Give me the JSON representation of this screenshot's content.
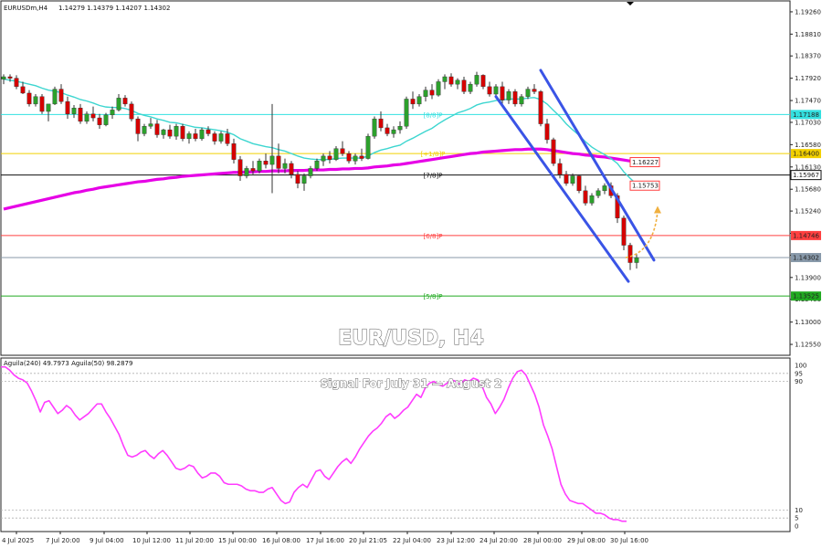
{
  "header": {
    "symbol": "EURUSDm,H4",
    "ohlc": "1.14279 1.14379 1.14207 1.14302"
  },
  "overlay": {
    "title": "EUR/USD, H4",
    "subtitle": "Signal For July 31 — August 2"
  },
  "colors": {
    "bull": "#2ca02c",
    "bear": "#d40000",
    "ema21": "#3dd6d0",
    "ema200": "#e600e6",
    "channel": "#3a54e6",
    "indicator": "#ff3cff",
    "arrow": "#f0b040"
  },
  "chart_data": [
    {
      "type": "candlestick",
      "name_label": "EURUSDm,H4",
      "y_ticks": [
        "1.19260",
        "1.18810",
        "1.18370",
        "1.17920",
        "1.17470",
        "1.17030",
        "1.16580",
        "1.16130",
        "1.15680",
        "1.15240",
        "1.14790",
        "1.14350",
        "1.13900",
        "1.13460",
        "1.13000",
        "1.12550"
      ],
      "ylim": [
        1.1233,
        1.1948
      ],
      "x_ticks": [
        "4 Jul 2025",
        "7 Jul 20:00",
        "9 Jul 04:00",
        "10 Jul 12:00",
        "11 Jul 20:00",
        "15 Jul 00:00",
        "16 Jul 08:00",
        "17 Jul 16:00",
        "20 Jul 21:05",
        "22 Jul 04:00",
        "23 Jul 12:00",
        "24 Jul 20:00",
        "28 Jul 00:00",
        "29 Jul 08:00",
        "30 Jul 16:00"
      ],
      "horizontal_lines": [
        {
          "label": "[+1/8]P",
          "value": 1.164,
          "price_label": "1.16400",
          "color": "#f2d000"
        },
        {
          "label": "[8/8]P",
          "value": 1.17188,
          "price_label": "1.17188",
          "color": "#33e0e0"
        },
        {
          "label": "[7/8]P",
          "value": 1.15967,
          "price_label": "1.15967",
          "color": "#111111"
        },
        {
          "label": "[6/8]P",
          "value": 1.14746,
          "price_label": "1.14746",
          "color": "#ff4040"
        },
        {
          "label": "[5/8]P",
          "value": 1.13525,
          "price_label": "1.13525",
          "color": "#22aa22"
        },
        {
          "label": "",
          "value": 1.14302,
          "price_label": "1.14302",
          "color": "#8899aa"
        }
      ],
      "annotations": [
        {
          "text": "1.16227",
          "value": 1.16227,
          "color": "#ff4040"
        },
        {
          "text": "1.15753",
          "value": 1.15753,
          "color": "#ff4040"
        }
      ],
      "candles": [
        [
          1.179,
          1.18,
          1.178,
          1.1795
        ],
        [
          1.1795,
          1.18,
          1.1785,
          1.1792
        ],
        [
          1.1792,
          1.1798,
          1.177,
          1.1775
        ],
        [
          1.1775,
          1.1785,
          1.176,
          1.1762
        ],
        [
          1.1762,
          1.1768,
          1.1735,
          1.174
        ],
        [
          1.174,
          1.176,
          1.1735,
          1.1755
        ],
        [
          1.1755,
          1.176,
          1.172,
          1.1725
        ],
        [
          1.1725,
          1.173,
          1.1705,
          1.174
        ],
        [
          1.174,
          1.1775,
          1.1738,
          1.177
        ],
        [
          1.177,
          1.178,
          1.174,
          1.1745
        ],
        [
          1.1745,
          1.1755,
          1.171,
          1.172
        ],
        [
          1.172,
          1.1738,
          1.1712,
          1.1732
        ],
        [
          1.1732,
          1.174,
          1.17,
          1.1705
        ],
        [
          1.1705,
          1.1725,
          1.17,
          1.172
        ],
        [
          1.172,
          1.1735,
          1.1705,
          1.1712
        ],
        [
          1.1712,
          1.172,
          1.169,
          1.1698
        ],
        [
          1.1698,
          1.1722,
          1.1695,
          1.1718
        ],
        [
          1.1718,
          1.1735,
          1.171,
          1.1728
        ],
        [
          1.1728,
          1.176,
          1.1725,
          1.1752
        ],
        [
          1.1752,
          1.1758,
          1.1735,
          1.174
        ],
        [
          1.174,
          1.1745,
          1.1705,
          1.171
        ],
        [
          1.171,
          1.1715,
          1.1665,
          1.168
        ],
        [
          1.168,
          1.17,
          1.1675,
          1.1695
        ],
        [
          1.1695,
          1.1712,
          1.169,
          1.17
        ],
        [
          1.17,
          1.1708,
          1.1672,
          1.1678
        ],
        [
          1.1678,
          1.169,
          1.167,
          1.1688
        ],
        [
          1.1688,
          1.1698,
          1.167,
          1.1675
        ],
        [
          1.1675,
          1.17,
          1.1668,
          1.1695
        ],
        [
          1.1695,
          1.17,
          1.1665,
          1.167
        ],
        [
          1.167,
          1.1685,
          1.166,
          1.168
        ],
        [
          1.168,
          1.169,
          1.1665,
          1.167
        ],
        [
          1.167,
          1.1692,
          1.1666,
          1.1688
        ],
        [
          1.1688,
          1.1695,
          1.1675,
          1.168
        ],
        [
          1.168,
          1.1685,
          1.1658,
          1.1665
        ],
        [
          1.1665,
          1.1685,
          1.166,
          1.168
        ],
        [
          1.168,
          1.169,
          1.1655,
          1.166
        ],
        [
          1.166,
          1.167,
          1.162,
          1.1628
        ],
        [
          1.1628,
          1.1635,
          1.1585,
          1.1595
        ],
        [
          1.1595,
          1.1615,
          1.159,
          1.161
        ],
        [
          1.161,
          1.1625,
          1.1598,
          1.1605
        ],
        [
          1.1605,
          1.163,
          1.16,
          1.1625
        ],
        [
          1.1625,
          1.164,
          1.161,
          1.1618
        ],
        [
          1.1618,
          1.174,
          1.156,
          1.1635
        ],
        [
          1.1635,
          1.166,
          1.16,
          1.161
        ],
        [
          1.161,
          1.163,
          1.16,
          1.162
        ],
        [
          1.162,
          1.1625,
          1.159,
          1.1598
        ],
        [
          1.1598,
          1.1605,
          1.157,
          1.158
        ],
        [
          1.158,
          1.16,
          1.1565,
          1.1595
        ],
        [
          1.1595,
          1.1615,
          1.159,
          1.161
        ],
        [
          1.161,
          1.163,
          1.1605,
          1.1625
        ],
        [
          1.1625,
          1.164,
          1.1615,
          1.1635
        ],
        [
          1.1635,
          1.1645,
          1.162,
          1.1628
        ],
        [
          1.1628,
          1.1655,
          1.1625,
          1.165
        ],
        [
          1.165,
          1.1665,
          1.1635,
          1.164
        ],
        [
          1.164,
          1.1645,
          1.162,
          1.1625
        ],
        [
          1.1625,
          1.164,
          1.1618,
          1.1635
        ],
        [
          1.1635,
          1.165,
          1.1625,
          1.163
        ],
        [
          1.163,
          1.168,
          1.1628,
          1.1675
        ],
        [
          1.1675,
          1.1715,
          1.167,
          1.171
        ],
        [
          1.171,
          1.1725,
          1.1685,
          1.1692
        ],
        [
          1.1692,
          1.17,
          1.1675,
          1.168
        ],
        [
          1.168,
          1.1695,
          1.1672,
          1.1688
        ],
        [
          1.1688,
          1.1705,
          1.168,
          1.1695
        ],
        [
          1.1695,
          1.1755,
          1.169,
          1.175
        ],
        [
          1.175,
          1.1765,
          1.173,
          1.174
        ],
        [
          1.174,
          1.176,
          1.1735,
          1.1755
        ],
        [
          1.1755,
          1.1775,
          1.1745,
          1.1768
        ],
        [
          1.1768,
          1.178,
          1.175,
          1.1758
        ],
        [
          1.1758,
          1.179,
          1.1755,
          1.1785
        ],
        [
          1.1785,
          1.18,
          1.177,
          1.1795
        ],
        [
          1.1795,
          1.1802,
          1.1775,
          1.178
        ],
        [
          1.178,
          1.1792,
          1.177,
          1.1788
        ],
        [
          1.1788,
          1.1795,
          1.176,
          1.1765
        ],
        [
          1.1765,
          1.1785,
          1.176,
          1.178
        ],
        [
          1.178,
          1.1805,
          1.1775,
          1.1798
        ],
        [
          1.1798,
          1.18,
          1.177,
          1.1775
        ],
        [
          1.1775,
          1.1785,
          1.1755,
          1.176
        ],
        [
          1.176,
          1.178,
          1.1755,
          1.1775
        ],
        [
          1.1775,
          1.1785,
          1.174,
          1.1748
        ],
        [
          1.1748,
          1.177,
          1.174,
          1.1765
        ],
        [
          1.1765,
          1.177,
          1.1735,
          1.174
        ],
        [
          1.174,
          1.176,
          1.1735,
          1.1755
        ],
        [
          1.1755,
          1.1775,
          1.175,
          1.177
        ],
        [
          1.177,
          1.178,
          1.176,
          1.1765
        ],
        [
          1.1765,
          1.1768,
          1.1695,
          1.17
        ],
        [
          1.17,
          1.171,
          1.166,
          1.1668
        ],
        [
          1.1668,
          1.1672,
          1.1615,
          1.162
        ],
        [
          1.162,
          1.163,
          1.159,
          1.1598
        ],
        [
          1.1598,
          1.1605,
          1.1575,
          1.158
        ],
        [
          1.158,
          1.16,
          1.1575,
          1.1595
        ],
        [
          1.1595,
          1.1598,
          1.156,
          1.1565
        ],
        [
          1.1565,
          1.1575,
          1.1535,
          1.154
        ],
        [
          1.154,
          1.156,
          1.1535,
          1.1555
        ],
        [
          1.1555,
          1.157,
          1.155,
          1.1565
        ],
        [
          1.1565,
          1.158,
          1.1558,
          1.1575
        ],
        [
          1.1575,
          1.1582,
          1.155,
          1.1555
        ],
        [
          1.1555,
          1.156,
          1.15,
          1.151
        ],
        [
          1.151,
          1.1515,
          1.1445,
          1.1455
        ],
        [
          1.1455,
          1.146,
          1.1405,
          1.142
        ],
        [
          1.142,
          1.1438,
          1.1408,
          1.143
        ]
      ],
      "ema21": [
        1.179,
        1.1788,
        1.1786,
        1.1783,
        1.178,
        1.1777,
        1.1772,
        1.1768,
        1.1766,
        1.1763,
        1.1758,
        1.1754,
        1.1749,
        1.1746,
        1.1742,
        1.1737,
        1.1734,
        1.1733,
        1.1733,
        1.1731,
        1.1727,
        1.1721,
        1.1717,
        1.1714,
        1.171,
        1.1707,
        1.1703,
        1.1702,
        1.1699,
        1.1696,
        1.1693,
        1.1692,
        1.169,
        1.1688,
        1.1686,
        1.1683,
        1.1678,
        1.167,
        1.1665,
        1.166,
        1.1657,
        1.1654,
        1.1652,
        1.1648,
        1.1645,
        1.164,
        1.1635,
        1.1631,
        1.1629,
        1.1628,
        1.1628,
        1.1628,
        1.163,
        1.1631,
        1.1631,
        1.1631,
        1.1631,
        1.1635,
        1.1642,
        1.1647,
        1.165,
        1.1654,
        1.1657,
        1.1665,
        1.1671,
        1.1678,
        1.1685,
        1.1691,
        1.17,
        1.1708,
        1.1715,
        1.1722,
        1.1726,
        1.1731,
        1.1738,
        1.1742,
        1.1744,
        1.1747,
        1.1748,
        1.175,
        1.175,
        1.175,
        1.1752,
        1.1753,
        1.1749,
        1.174,
        1.1727,
        1.1715,
        1.17,
        1.1688,
        1.1677,
        1.1664,
        1.1653,
        1.1645,
        1.1638,
        1.163,
        1.162,
        1.1603,
        1.159,
        1.1578
      ],
      "ema200": [
        1.1528,
        1.1531,
        1.1534,
        1.1537,
        1.154,
        1.1543,
        1.1546,
        1.1549,
        1.1552,
        1.1555,
        1.1558,
        1.1561,
        1.1563,
        1.1566,
        1.1568,
        1.1571,
        1.1573,
        1.1575,
        1.1577,
        1.1579,
        1.1581,
        1.1583,
        1.1584,
        1.1586,
        1.1588,
        1.1589,
        1.1591,
        1.1592,
        1.1594,
        1.1595,
        1.1596,
        1.1597,
        1.1598,
        1.1599,
        1.16,
        1.1601,
        1.1602,
        1.1602,
        1.1603,
        1.1603,
        1.1604,
        1.1604,
        1.1605,
        1.1605,
        1.1605,
        1.1606,
        1.1606,
        1.1606,
        1.1607,
        1.1607,
        1.1607,
        1.1608,
        1.1608,
        1.1609,
        1.1609,
        1.161,
        1.161,
        1.1611,
        1.1613,
        1.1614,
        1.1615,
        1.1617,
        1.1618,
        1.162,
        1.1622,
        1.1624,
        1.1626,
        1.1628,
        1.163,
        1.1632,
        1.1634,
        1.1636,
        1.1638,
        1.164,
        1.1641,
        1.1643,
        1.1644,
        1.1645,
        1.1646,
        1.1647,
        1.1648,
        1.1648,
        1.1649,
        1.1649,
        1.1649,
        1.1648,
        1.1646,
        1.1644,
        1.1642,
        1.164,
        1.1639,
        1.1637,
        1.1636,
        1.1634,
        1.1633,
        1.1631,
        1.1629,
        1.1627,
        1.1625,
        1.1623
      ],
      "channel": {
        "upper": [
          [
            84,
            1.1808
          ],
          [
            100,
            1.1425
          ]
        ],
        "lower": [
          [
            77,
            1.1755
          ],
          [
            97,
            1.1382
          ]
        ]
      },
      "projection": {
        "from": [
          97,
          1.143
        ],
        "to": [
          100,
          1.1525
        ]
      }
    },
    {
      "type": "line",
      "name_label": "Aguila(240) 49.7973  Aguila(50) 98.2879",
      "y_ticks": [
        "100",
        "95",
        "90",
        "10",
        "5",
        "0"
      ],
      "ylim": [
        0,
        100
      ],
      "levels": [
        95,
        90,
        10,
        5
      ],
      "values": [
        99,
        99,
        97,
        94,
        92,
        91,
        89,
        84,
        78,
        71,
        77,
        78,
        74,
        70,
        72,
        75,
        73,
        69,
        66,
        68,
        70,
        73,
        76,
        76,
        71,
        67,
        62,
        57,
        50,
        44,
        43,
        44,
        46,
        47,
        44,
        42,
        45,
        47,
        44,
        40,
        36,
        35,
        36,
        38,
        37,
        33,
        30,
        31,
        33,
        33,
        31,
        27,
        26,
        26,
        26,
        25,
        23,
        22,
        22,
        21,
        21,
        23,
        24,
        20,
        16,
        14,
        15,
        21,
        24,
        26,
        24,
        29,
        34,
        35,
        31,
        29,
        33,
        37,
        40,
        42,
        39,
        43,
        48,
        52,
        56,
        59,
        61,
        64,
        68,
        70,
        67,
        69,
        72,
        74,
        78,
        82,
        80,
        86,
        89,
        90,
        88,
        87,
        89,
        91,
        90,
        88,
        91,
        90,
        92,
        91,
        87,
        80,
        76,
        70,
        74,
        79,
        86,
        92,
        96,
        97,
        94,
        88,
        82,
        74,
        63,
        56,
        48,
        37,
        26,
        20,
        16,
        15,
        14,
        14,
        12,
        10,
        8,
        8,
        7,
        5,
        4,
        4,
        3,
        3
      ]
    }
  ]
}
